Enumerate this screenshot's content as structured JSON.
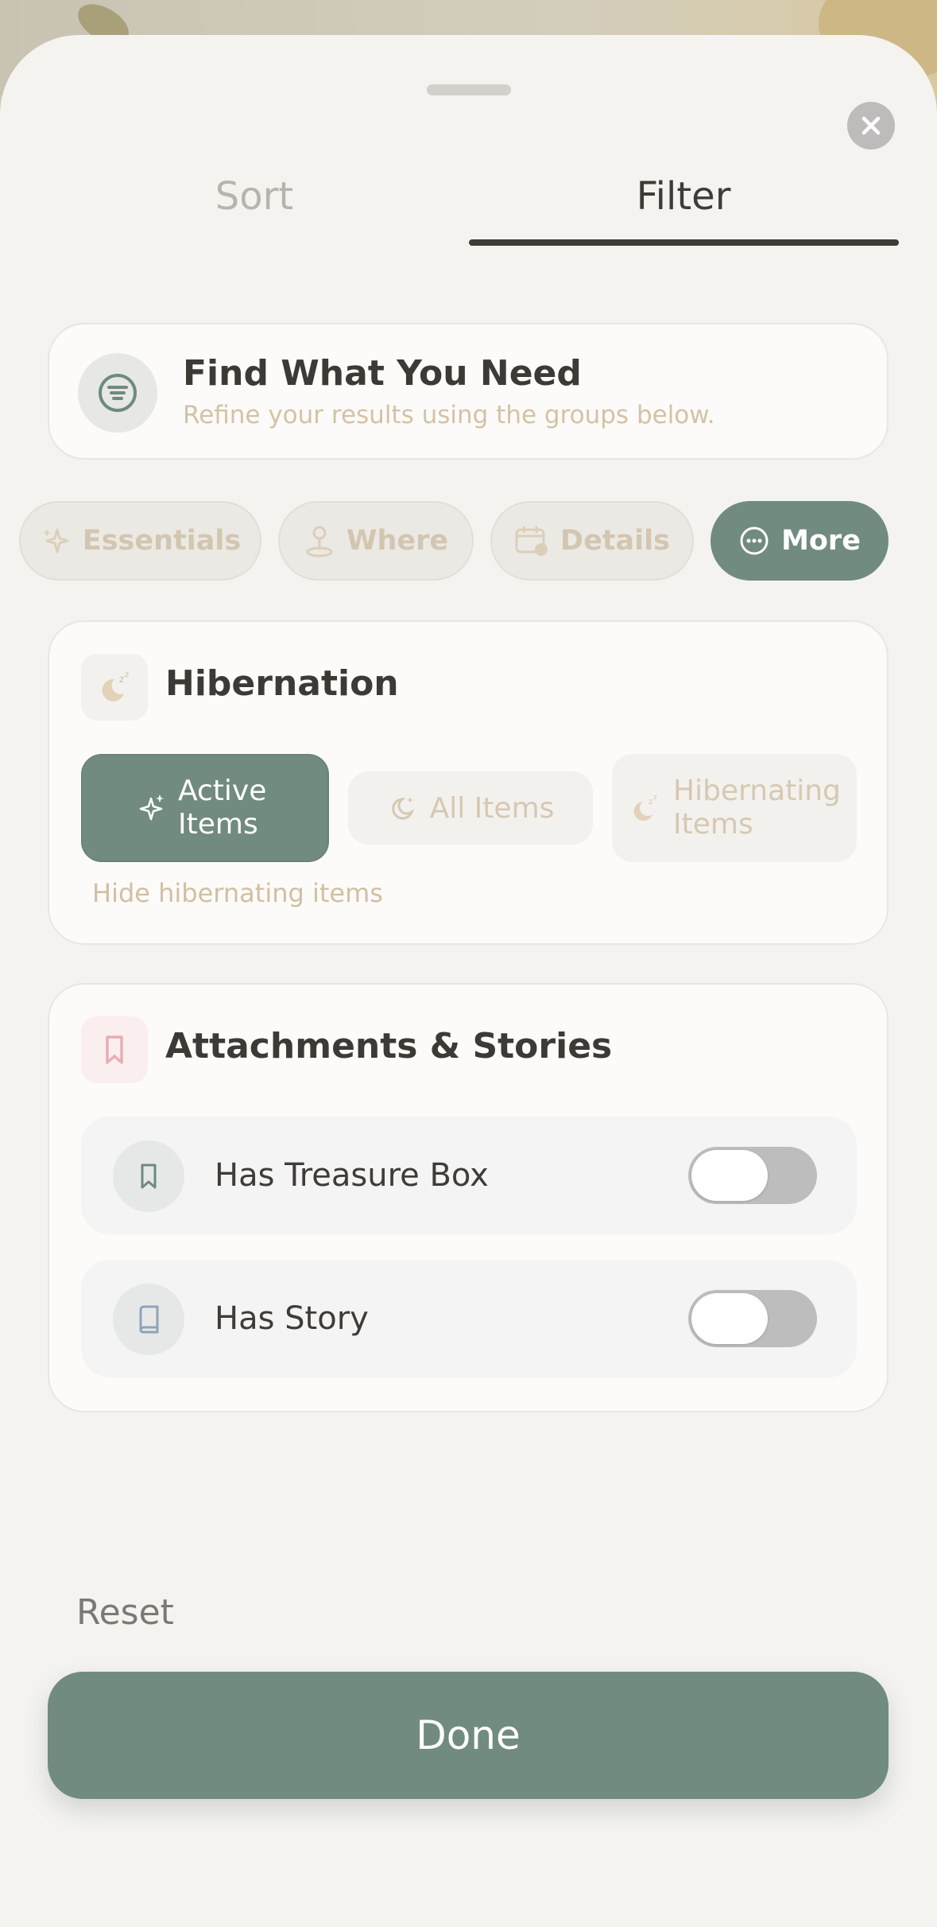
{
  "tabs": {
    "sort": "Sort",
    "filter": "Filter",
    "active": "filter"
  },
  "intro": {
    "title": "Find What You Need",
    "subtitle": "Refine your results using the groups below."
  },
  "chips": [
    {
      "label": "Essentials",
      "icon": "sparkle-icon",
      "active": false
    },
    {
      "label": "Where",
      "icon": "map-pin-icon",
      "active": false
    },
    {
      "label": "Details",
      "icon": "calendar-icon",
      "active": false
    },
    {
      "label": "More",
      "icon": "more-circle-icon",
      "active": true
    }
  ],
  "hibernation": {
    "title": "Hibernation",
    "icon": "sleeping-moon-icon",
    "options": [
      {
        "label": "Active Items",
        "icon": "sparkle-icon",
        "selected": true
      },
      {
        "label": "All Items",
        "icon": "moon-icon",
        "selected": false
      },
      {
        "label": "Hibernating Items",
        "icon": "sleeping-moon-icon",
        "selected": false
      }
    ],
    "hint": "Hide hibernating items"
  },
  "attachments": {
    "title": "Attachments & Stories",
    "icon": "bookmark-icon",
    "rows": [
      {
        "label": "Has Treasure Box",
        "icon": "bookmark-icon",
        "on": false
      },
      {
        "label": "Has Story",
        "icon": "book-icon",
        "on": false
      }
    ]
  },
  "footer": {
    "reset": "Reset",
    "done": "Done"
  },
  "colors": {
    "accent": "#718b7f",
    "sheet": "#f4f3ef",
    "muted_text": "#d4c2a6",
    "toggle_off": "#bdbdbd"
  }
}
